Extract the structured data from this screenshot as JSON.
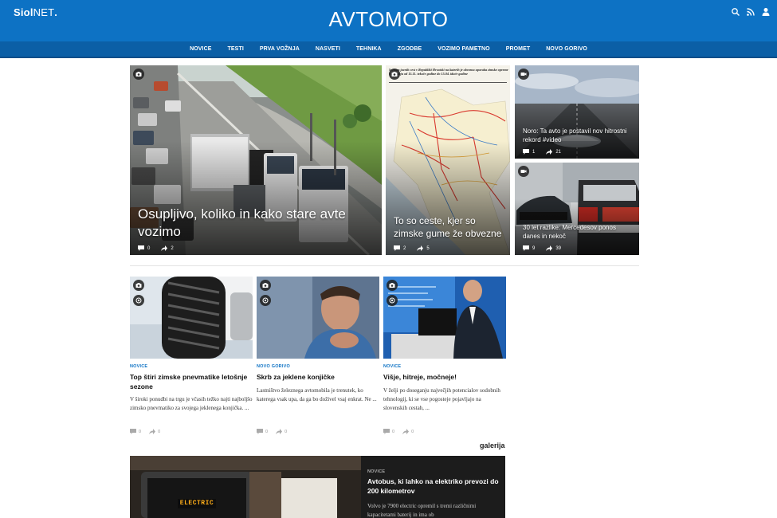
{
  "header": {
    "brand_main": "Siol",
    "brand_net": "NET",
    "brand_dot": ".",
    "site_title": "AVTOMOTO",
    "icons": [
      "search-icon",
      "rss-icon",
      "user-icon"
    ]
  },
  "nav": {
    "items": [
      "NOVICE",
      "TESTI",
      "PRVA VOŽNJA",
      "NASVETI",
      "TEHNIKA",
      "ZGODBE",
      "VOZIMO PAMETNO",
      "PROMET",
      "NOVO GORIVO"
    ]
  },
  "hero": [
    {
      "title": "Osupljivo, koliko in kako stare avte vozimo",
      "comments": "0",
      "shares": "2",
      "badge": "camera-icon"
    },
    {
      "title": "To so ceste, kjer so zimske gume že obvezne",
      "comments": "2",
      "shares": "5",
      "badge": "camera-icon",
      "map_caption": "Seznam javnih cest v Republiki Hrvatski na katerih je obvezna uporaba zimske opreme v razdobju od 15.11. tekoče godine do 15.04. iduće godine"
    },
    {
      "title": "Noro: Ta avto je postavil nov hitrostni rekord #video",
      "comments": "1",
      "shares": "21",
      "badge": "video-icon"
    },
    {
      "title": "30 let razlike: Mercedesov ponos danes in nekoč",
      "comments": "9",
      "shares": "39",
      "badge": "video-icon"
    }
  ],
  "articles": [
    {
      "category": "NOVICE",
      "title": "Top štiri zimske pnevmatike letošnje sezone",
      "lead": "V široki ponudbi na trgu je včasih težko najti najboljšo zimsko pnevmatiko za svojega jeklenega konjička. ...",
      "comments": "0",
      "shares": "0"
    },
    {
      "category": "NOVO GORIVO",
      "title": "Skrb za jeklene konjičke",
      "lead": "Lastništvo železnega avtomobila je trenutek, ko katerega vsak upa, da ga bo doživel vsaj enkrat. Ne ...",
      "comments": "0",
      "shares": "0"
    },
    {
      "category": "NOVICE",
      "title": "Višje, hitreje, močneje!",
      "lead": "V želji po doseganju največjih potencialov sodobnih tehnologij, ki se vse pogosteje pojavljajo na slovenskih cestah, ...",
      "comments": "0",
      "shares": "0"
    }
  ],
  "gallery": {
    "label": "galerija",
    "category": "NOVICE",
    "title": "Avtobus, ki lahko na elektriko prevozi do 200 kilometrov",
    "lead": "Volvo je 7900 electric opremil s tremi različnimi kapacitetami baterij in ima ob",
    "bus_sign": "ELECTRIC"
  },
  "colors": {
    "brand_blue": "#0d72c4",
    "nav_blue": "#0b5fa6",
    "category_blue": "#0d72c4"
  }
}
